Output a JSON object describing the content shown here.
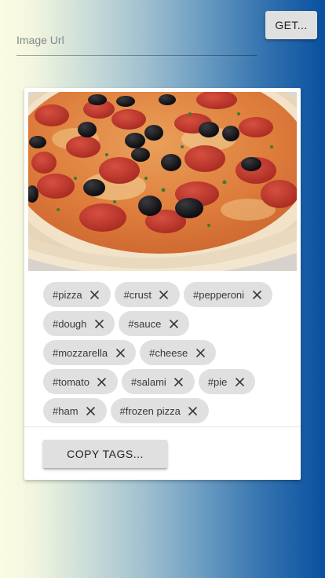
{
  "url_input": {
    "placeholder": "Image Url",
    "value": ""
  },
  "get_button": {
    "label": "GET..."
  },
  "card": {
    "image": {
      "alt": "pizza",
      "icon": "pizza-photo"
    },
    "tag_rows": [
      [
        "#pizza",
        "#crust",
        "#pepperoni"
      ],
      [
        "#dough",
        "#sauce"
      ],
      [
        "#mozzarella",
        "#cheese"
      ],
      [
        "#tomato",
        "#salami",
        "#pie"
      ],
      [
        "#ham",
        "#frozen pizza"
      ]
    ],
    "chip_remove_icon": "close-icon",
    "copy_button": {
      "label": "COPY TAGS..."
    }
  },
  "colors": {
    "gradient_left": "#fbfce2",
    "gradient_right": "#08509f",
    "chip_bg": "#e0e0e0",
    "button_bg": "#e0e0e0"
  }
}
